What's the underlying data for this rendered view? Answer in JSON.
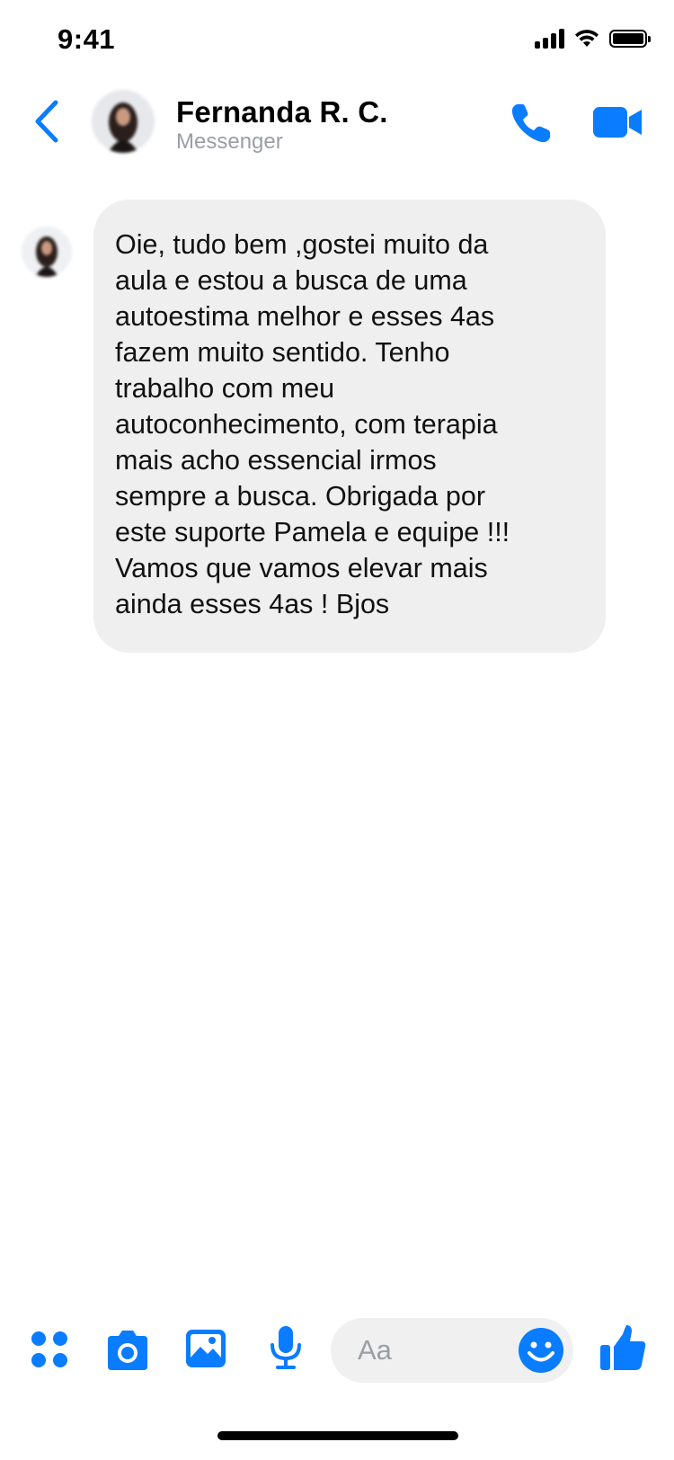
{
  "status_bar": {
    "time": "9:41"
  },
  "header": {
    "contact_name": "Fernanda R. C.",
    "subtitle": "Messenger"
  },
  "conversation": {
    "messages": [
      {
        "sender": "contact",
        "text": "Oie, tudo bem ,gostei muito da\naula e estou a busca de uma\nautoestima melhor e esses 4as\nfazem muito sentido. Tenho\ntrabalho com meu\nautoconhecimento, com terapia\nmais acho essencial irmos\nsempre a busca. Obrigada por\neste suporte Pamela e equipe !!!\nVamos que vamos elevar mais\nainda esses 4as ! Bjos"
      }
    ]
  },
  "composer": {
    "placeholder": "Aa"
  },
  "icons": {
    "back": "chevron-left-icon",
    "call": "phone-icon",
    "video": "video-camera-icon",
    "apps": "four-dots-icon",
    "camera": "camera-icon",
    "gallery": "image-icon",
    "mic": "microphone-icon",
    "emoji": "smiley-icon",
    "like": "thumbs-up-icon"
  },
  "colors": {
    "accent": "#0a7cff",
    "bubble": "#efefef",
    "muted": "#9a9ea6"
  }
}
